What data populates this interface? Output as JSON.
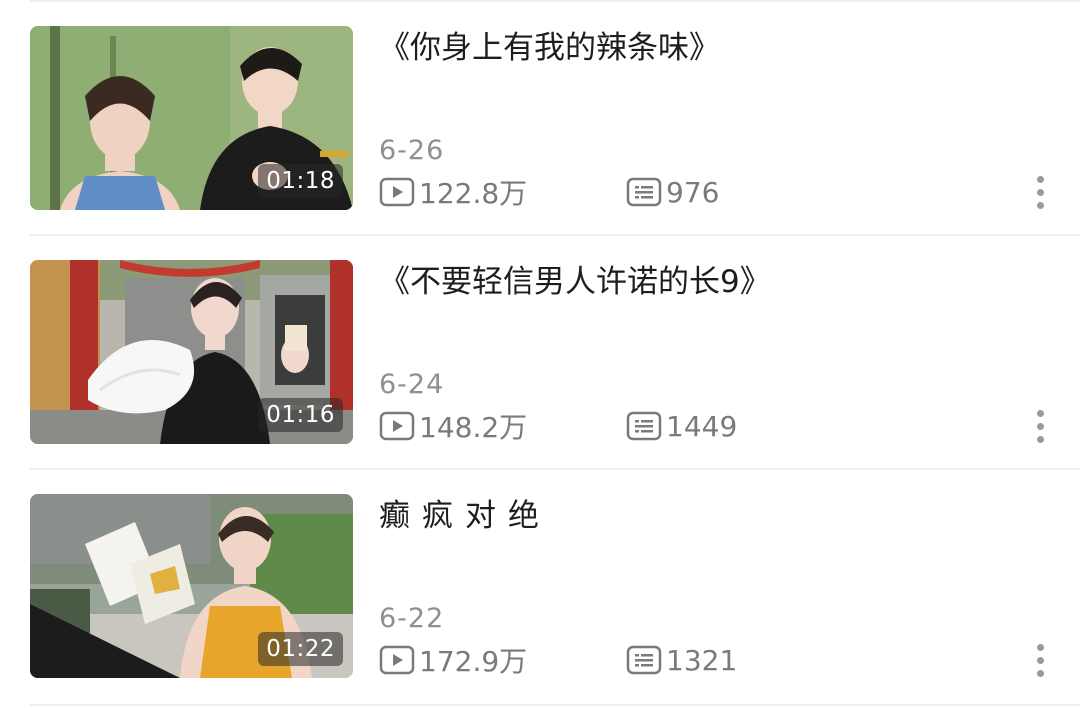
{
  "videos": [
    {
      "title": "《你身上有我的辣条味》",
      "duration": "01:18",
      "date": "6-26",
      "plays": "122.8万",
      "comments": "976",
      "title_spaced": false
    },
    {
      "title": "《不要轻信男人许诺的长9》",
      "duration": "01:16",
      "date": "6-24",
      "plays": "148.2万",
      "comments": "1449",
      "title_spaced": false
    },
    {
      "title": "癫疯对绝",
      "duration": "01:22",
      "date": "6-22",
      "plays": "172.9万",
      "comments": "1321",
      "title_spaced": true
    }
  ],
  "icons": {
    "plays": "play-count-icon",
    "comments": "danmaku-comment-icon",
    "more": "more-vertical-icon"
  },
  "colors": {
    "text": "#1e1e1e",
    "meta": "#8f8f8f",
    "divider": "#eeeeee"
  }
}
